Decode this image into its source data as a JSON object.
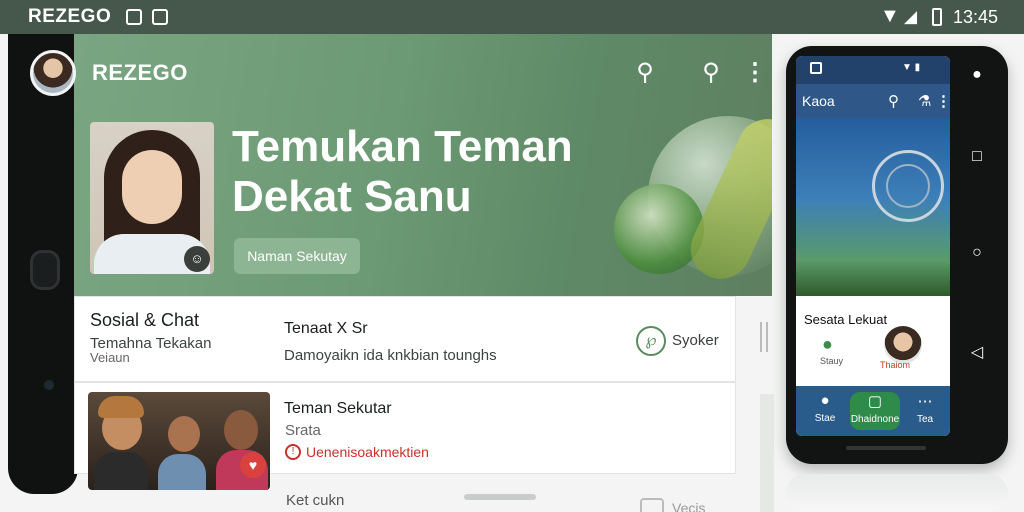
{
  "status_bar": {
    "brand": "REZEGO",
    "time": "13:45",
    "icons": [
      "app-icon-1",
      "gallery-icon",
      "wifi-icon",
      "signal-icon",
      "battery-icon"
    ]
  },
  "app": {
    "logo": "REZEGO",
    "header_icons": [
      "search-icon",
      "search-user-icon",
      "more-vertical-icon"
    ]
  },
  "hero": {
    "title": "Temukan Teman Dekat Sanu",
    "chip_label": "Naman Sekutay"
  },
  "card_social": {
    "title": "Sosial & Chat",
    "subtitle": "Temahna Tekakan",
    "subtitle2": "Veiaun",
    "chat_name": "Tenaat X Sr",
    "chat_message": "Damoyaikn ida knkbian tounghs",
    "speak_label": "Syoker"
  },
  "card_nearby": {
    "title": "Teman Sekutar",
    "subtitle": "Srata",
    "alert": "Uenenisoakmektien"
  },
  "bottom": {
    "peek_left": "Ket cukn",
    "peek_right": "Vecis"
  },
  "right_phone": {
    "app_title": "Kaoa",
    "section_title": "Sesata Lekuat",
    "contact_1": "Stauy",
    "contact_2": "Thaiom",
    "nav": [
      {
        "label": "Stae",
        "icon": "user-icon"
      },
      {
        "label": "Dhaidnone",
        "icon": "chat-icon"
      },
      {
        "label": "Tea",
        "icon": "more-icon"
      }
    ]
  },
  "colors": {
    "hero_green": "#6c9a74",
    "status_bar": "#46574c",
    "alert_red": "#c9302c",
    "right_phone_blue": "#2f5889"
  }
}
